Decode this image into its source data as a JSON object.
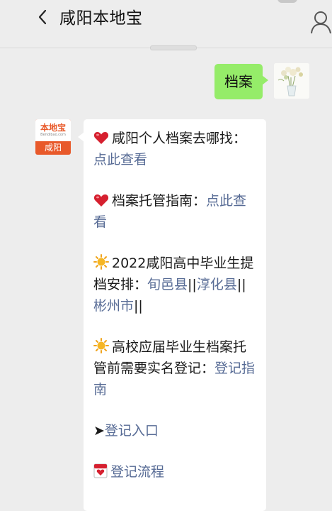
{
  "header": {
    "title": "咸阳本地宝"
  },
  "user_message": {
    "text": "档案"
  },
  "bot": {
    "avatar": {
      "brand": "本地宝",
      "domain": "Bendibao.com",
      "city": "咸阳"
    },
    "items": [
      {
        "icon": "heart-icon",
        "text": "咸阳个人档案去哪找：",
        "link": "点此查看"
      },
      {
        "icon": "heart-icon",
        "text": "档案托管指南：",
        "link": "点此查看"
      },
      {
        "icon": "sun-icon",
        "text": "2022咸阳高中毕业生提档安排：",
        "links": [
          "旬邑县",
          "淳化县",
          "彬州市"
        ]
      },
      {
        "icon": "sun-icon",
        "text": "高校应届毕业生档案托管前需要实名登记：",
        "link": "登记指南"
      },
      {
        "icon": "arrow-icon",
        "arrow": "➤",
        "link": "登记入口"
      },
      {
        "icon": "calendar-icon",
        "link": "登记流程"
      }
    ]
  },
  "colors": {
    "background": "#ededed",
    "my_bubble": "#95ec69",
    "bot_bubble": "#ffffff",
    "link": "#576b95",
    "brand": "#e8592a"
  }
}
